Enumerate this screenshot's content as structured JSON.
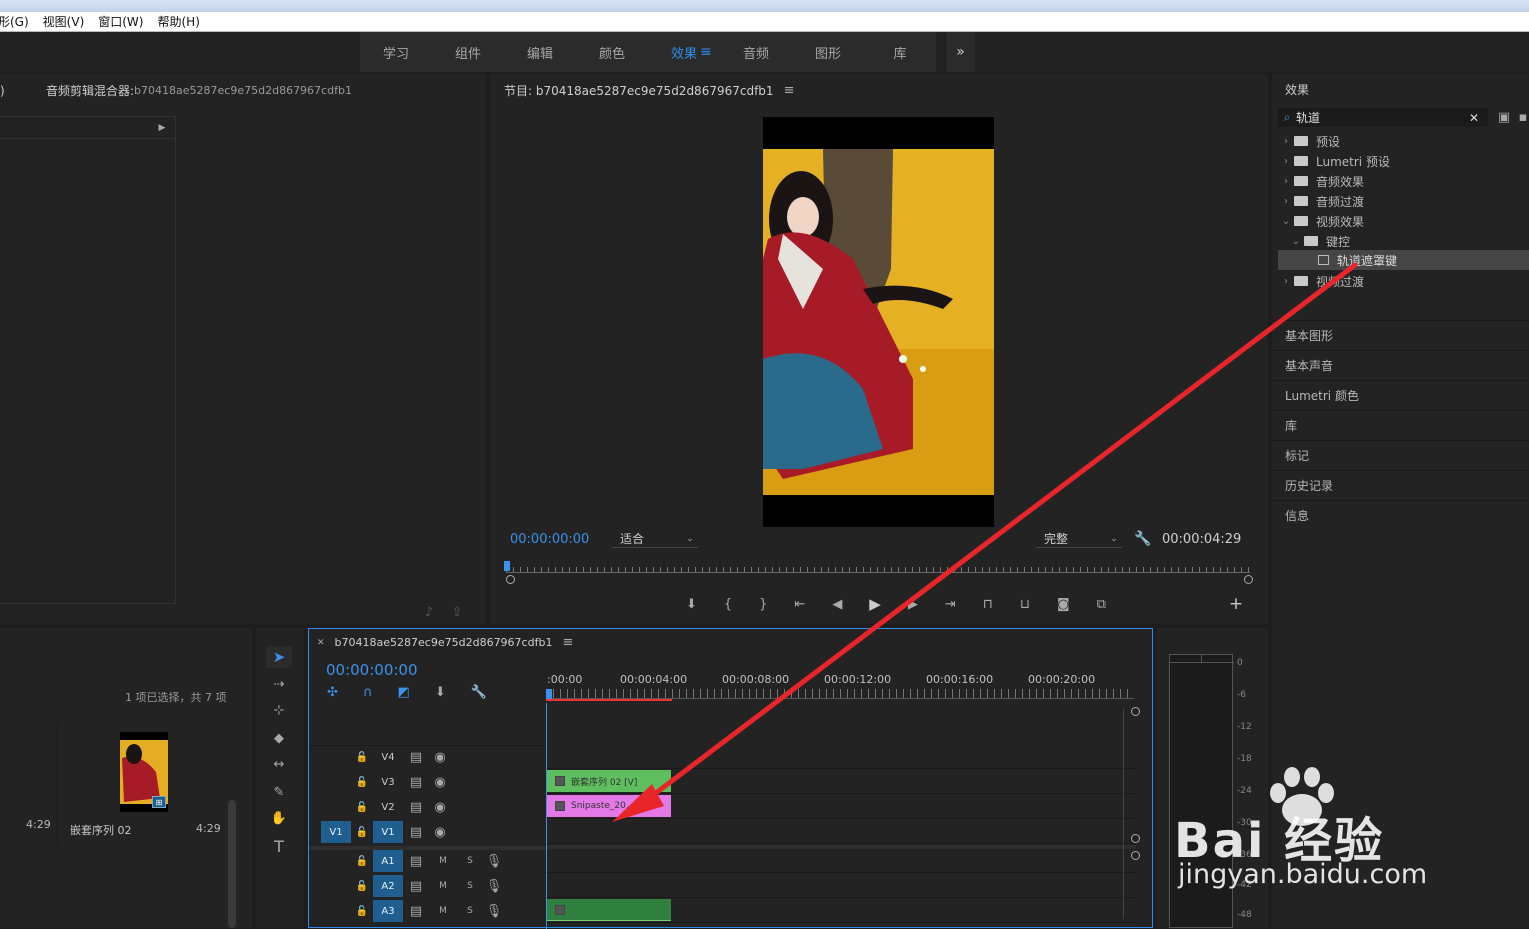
{
  "menu": [
    "形(G)",
    "视图(V)",
    "窗口(W)",
    "帮助(H)"
  ],
  "workspace_tabs": [
    {
      "label": "学习",
      "active": false
    },
    {
      "label": "组件",
      "active": false
    },
    {
      "label": "编辑",
      "active": false
    },
    {
      "label": "颜色",
      "active": false
    },
    {
      "label": "效果",
      "active": true
    },
    {
      "label": "音频",
      "active": false
    },
    {
      "label": "图形",
      "active": false
    },
    {
      "label": "库",
      "active": false
    }
  ],
  "workspace_more": "»",
  "mixer": {
    "edge_glyph": ")",
    "title": "音频剪辑混合器:",
    "seq": "b70418ae5287ec9e75d2d867967cdfb1"
  },
  "program": {
    "title": "节目: b70418ae5287ec9e75d2d867967cdfb1",
    "timecode": "00:00:00:00",
    "fit": "适合",
    "quality": "完整",
    "duration": "00:00:04:29"
  },
  "effects": {
    "title": "效果",
    "search_value": "轨道",
    "tree": [
      {
        "label": "预设",
        "level": 0,
        "expanded": false
      },
      {
        "label": "Lumetri 预设",
        "level": 0,
        "expanded": false
      },
      {
        "label": "音频效果",
        "level": 0,
        "expanded": false
      },
      {
        "label": "音频过渡",
        "level": 0,
        "expanded": false
      },
      {
        "label": "视频效果",
        "level": 0,
        "expanded": true
      },
      {
        "label": "键控",
        "level": 1,
        "expanded": true
      },
      {
        "label": "轨道遮罩键",
        "level": 2,
        "selected": true
      },
      {
        "label": "视频过渡",
        "level": 0,
        "expanded": false
      }
    ]
  },
  "side_panels": [
    "基本图形",
    "基本声音",
    "Lumetri 颜色",
    "库",
    "标记",
    "历史记录",
    "信息"
  ],
  "project": {
    "status": "1 项已选择，共 7 项",
    "items": [
      {
        "name": "",
        "duration": "4:29"
      },
      {
        "name": "嵌套序列 02",
        "duration": "4:29"
      }
    ]
  },
  "timeline": {
    "title": "b70418ae5287ec9e75d2d867967cdfb1",
    "timecode": "00:00:00:00",
    "ruler": [
      ":00:00",
      "00:00:04:00",
      "00:00:08:00",
      "00:00:12:00",
      "00:00:16:00",
      "00:00:20:00"
    ],
    "video_tracks": [
      {
        "name": "V4",
        "source": ""
      },
      {
        "name": "V3",
        "source": ""
      },
      {
        "name": "V2",
        "source": ""
      },
      {
        "name": "V1",
        "source": "V1"
      }
    ],
    "audio_tracks": [
      {
        "name": "A1",
        "m": "M",
        "s": "S"
      },
      {
        "name": "A2",
        "m": "M",
        "s": "S"
      },
      {
        "name": "A3",
        "m": "M",
        "s": "S"
      }
    ],
    "clips": [
      {
        "label": "嵌套序列 02 [V]",
        "track": "V3",
        "color": "#5fbf5f"
      },
      {
        "label": "Snipaste_20...06_",
        "track": "V2",
        "color": "#e279e6"
      },
      {
        "label": "",
        "track": "A3",
        "color": "#2f7f3f"
      }
    ]
  },
  "meter_scale": [
    "0",
    "-6",
    "-12",
    "-18",
    "-24",
    "-30",
    "-36",
    "-42",
    "-48"
  ],
  "watermark": {
    "brand": "Bai 经验",
    "url": "jingyan.baidu.com"
  },
  "colors": {
    "accent": "#2d8ceb",
    "arrow": "#e8262a",
    "bg": "#232323"
  }
}
